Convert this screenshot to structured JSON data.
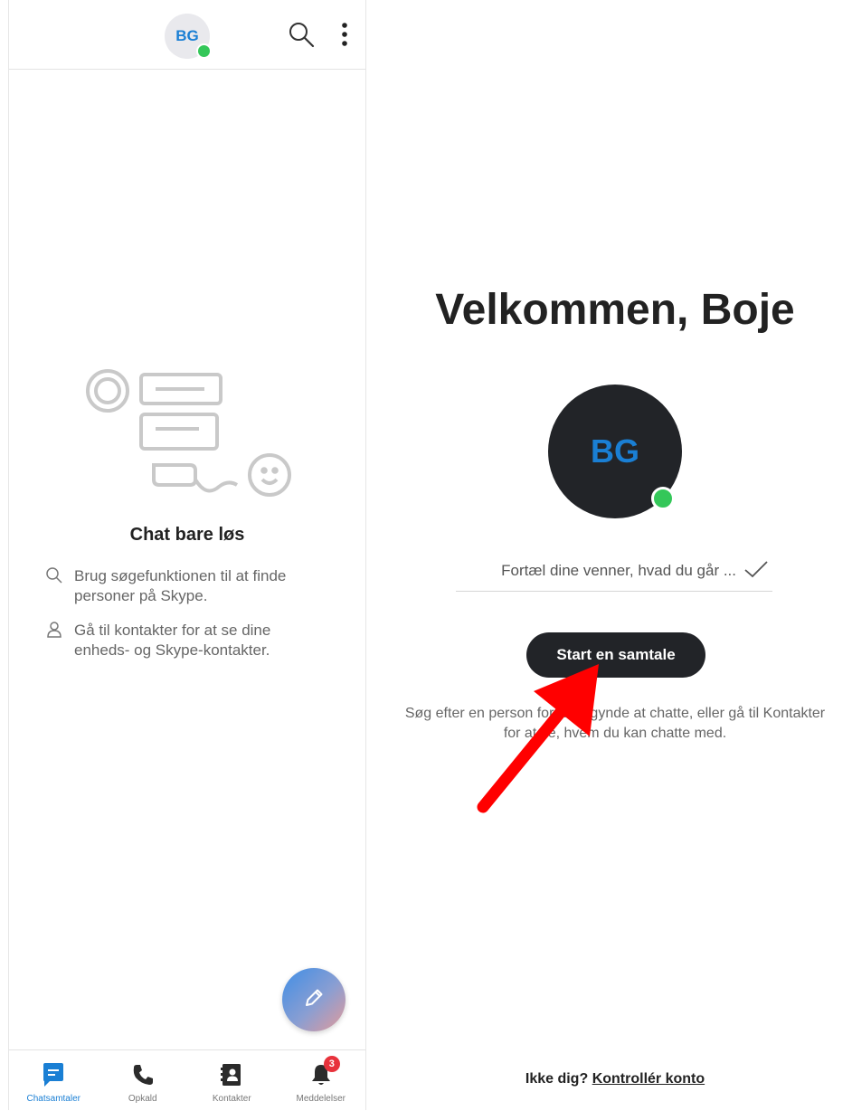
{
  "header": {
    "avatar_initials": "BG",
    "presence_color": "#34c759",
    "icons": [
      "search-icon",
      "more-vertical-icon"
    ]
  },
  "empty_state": {
    "title": "Chat bare løs",
    "hints": [
      {
        "icon": "search-icon",
        "text": "Brug søgefunktionen til at finde personer på Skype."
      },
      {
        "icon": "person-icon",
        "text": "Gå til kontakter for at se dine enheds- og Skype-kontakter."
      }
    ]
  },
  "fab": {
    "icon": "pencil-icon"
  },
  "bottom_nav": {
    "items": [
      {
        "label": "Chatsamtaler",
        "icon": "chat-icon",
        "active": true
      },
      {
        "label": "Opkald",
        "icon": "phone-icon",
        "active": false
      },
      {
        "label": "Kontakter",
        "icon": "contacts-icon",
        "active": false
      },
      {
        "label": "Meddelelser",
        "icon": "bell-icon",
        "active": false,
        "badge": "3"
      }
    ]
  },
  "welcome": {
    "title": "Velkommen, Boje",
    "avatar_initials": "BG",
    "mood_placeholder": "Fortæl dine venner, hvad du går ...",
    "start_button": "Start en samtale",
    "help_text": "Søg efter en person for at begynde at chatte, eller gå til Kontakter for at se, hvem du kan chatte med.",
    "not_you": "Ikke dig?",
    "verify_link": "Kontrollér konto"
  },
  "colors": {
    "accent": "#1a7fd4",
    "dark_button": "#222428",
    "badge": "#e8323c",
    "annotation_arrow": "#ff0000"
  }
}
